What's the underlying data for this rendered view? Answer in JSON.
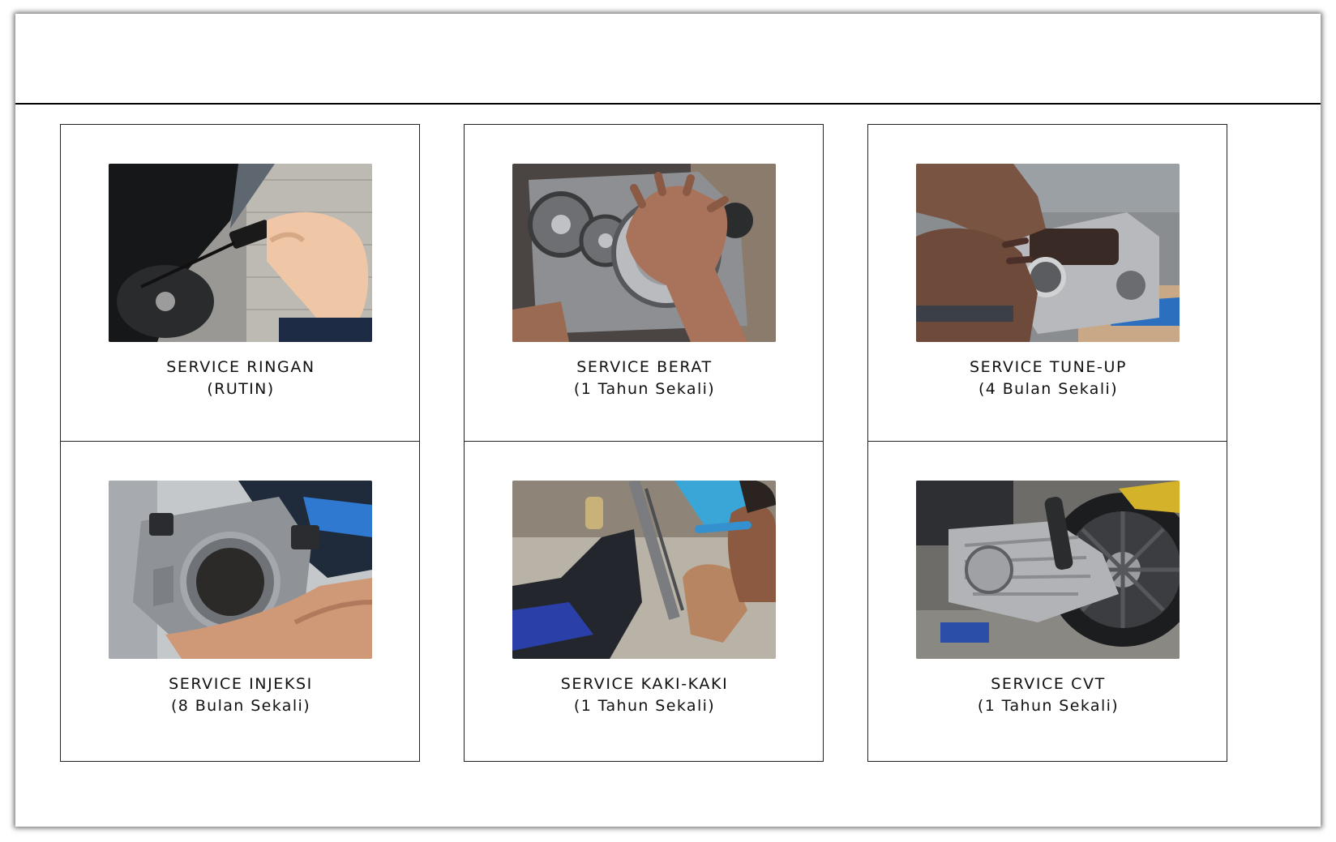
{
  "services": [
    {
      "title": "SERVICE RINGAN",
      "subtitle": "(RUTIN)",
      "photo_icon": "oil-dipstick-photo"
    },
    {
      "title": "SERVICE BERAT",
      "subtitle": "(1 Tahun Sekali)",
      "photo_icon": "engine-gears-photo"
    },
    {
      "title": "SERVICE TUNE-UP",
      "subtitle": "(4 Bulan Sekali)",
      "photo_icon": "cylinder-head-photo"
    },
    {
      "title": "SERVICE INJEKSI",
      "subtitle": "(8 Bulan Sekali)",
      "photo_icon": "throttle-body-photo"
    },
    {
      "title": "SERVICE KAKI-KAKI",
      "subtitle": "(1 Tahun Sekali)",
      "photo_icon": "suspension-repair-photo"
    },
    {
      "title": "SERVICE CVT",
      "subtitle": "(1 Tahun Sekali)",
      "photo_icon": "cvt-wheel-photo"
    }
  ]
}
